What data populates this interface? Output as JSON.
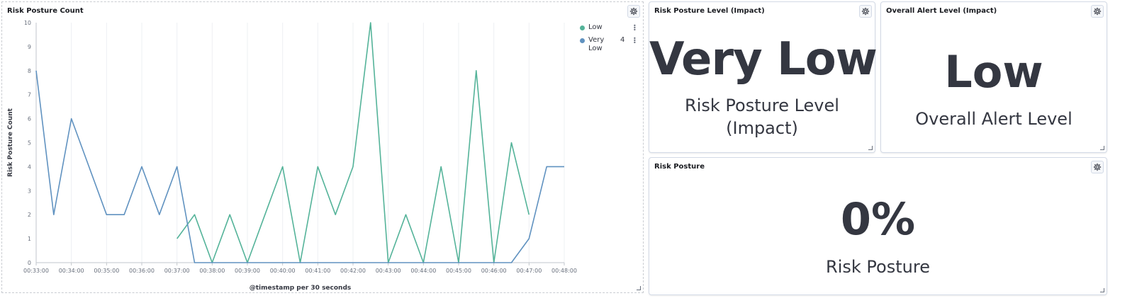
{
  "panels": {
    "risk_posture_count": {
      "title": "Risk Posture Count"
    },
    "risk_posture_level": {
      "title": "Risk Posture Level (Impact)",
      "value": "Very Low",
      "label_line1": "Risk Posture Level",
      "label_line2": "(Impact)"
    },
    "overall_alert_level": {
      "title": "Overall Alert Level (Impact)",
      "value": "Low",
      "label": "Overall Alert Level"
    },
    "risk_posture": {
      "title": "Risk Posture",
      "value": "0%",
      "label": "Risk Posture"
    }
  },
  "colors": {
    "low": "#54b399",
    "very_low": "#6092c0",
    "text": "#343741"
  },
  "chart_data": {
    "type": "line",
    "ylabel": "Risk Posture Count",
    "xlabel": "@timestamp per 30 seconds",
    "ylim": [
      0,
      10
    ],
    "yticks": [
      "0",
      "1",
      "2",
      "3",
      "4",
      "5",
      "6",
      "7",
      "8",
      "9",
      "10"
    ],
    "xticks": [
      "00:33:00",
      "00:34:00",
      "00:35:00",
      "00:36:00",
      "00:37:00",
      "00:38:00",
      "00:39:00",
      "00:40:00",
      "00:41:00",
      "00:42:00",
      "00:43:00",
      "00:44:00",
      "00:45:00",
      "00:46:00",
      "00:47:00",
      "00:48:00"
    ],
    "grid": true,
    "legend_position": "top-right",
    "series": [
      {
        "name": "Low",
        "color": "#54b399",
        "x": [
          "00:37:00",
          "00:37:30",
          "00:38:00",
          "00:38:30",
          "00:39:00",
          "00:39:30",
          "00:40:00",
          "00:40:30",
          "00:41:00",
          "00:41:30",
          "00:42:00",
          "00:42:30",
          "00:43:00",
          "00:43:30",
          "00:44:00",
          "00:44:30",
          "00:45:00",
          "00:45:30",
          "00:46:00",
          "00:46:30",
          "00:47:00"
        ],
        "values": [
          1,
          2,
          0,
          2,
          0,
          2,
          4,
          0,
          4,
          2,
          4,
          10,
          0,
          2,
          0,
          4,
          0,
          8,
          0,
          5,
          2
        ]
      },
      {
        "name": "Very Low",
        "name_line1": "Very",
        "name_line2": "Low",
        "legend_value": "4",
        "color": "#6092c0",
        "x": [
          "00:33:00",
          "00:33:30",
          "00:34:00",
          "00:34:30",
          "00:35:00",
          "00:35:30",
          "00:36:00",
          "00:36:30",
          "00:37:00",
          "00:37:30",
          "00:38:00",
          "00:38:30",
          "00:39:00",
          "00:39:30",
          "00:40:00",
          "00:40:30",
          "00:41:00",
          "00:41:30",
          "00:42:00",
          "00:42:30",
          "00:43:00",
          "00:43:30",
          "00:44:00",
          "00:44:30",
          "00:45:00",
          "00:45:30",
          "00:46:00",
          "00:46:30",
          "00:47:00",
          "00:47:30",
          "00:48:00"
        ],
        "values": [
          8,
          2,
          6,
          4,
          2,
          2,
          4,
          2,
          4,
          0,
          0,
          0,
          0,
          0,
          0,
          0,
          0,
          0,
          0,
          0,
          0,
          0,
          0,
          0,
          0,
          0,
          0,
          0,
          1,
          4,
          4
        ]
      }
    ]
  }
}
